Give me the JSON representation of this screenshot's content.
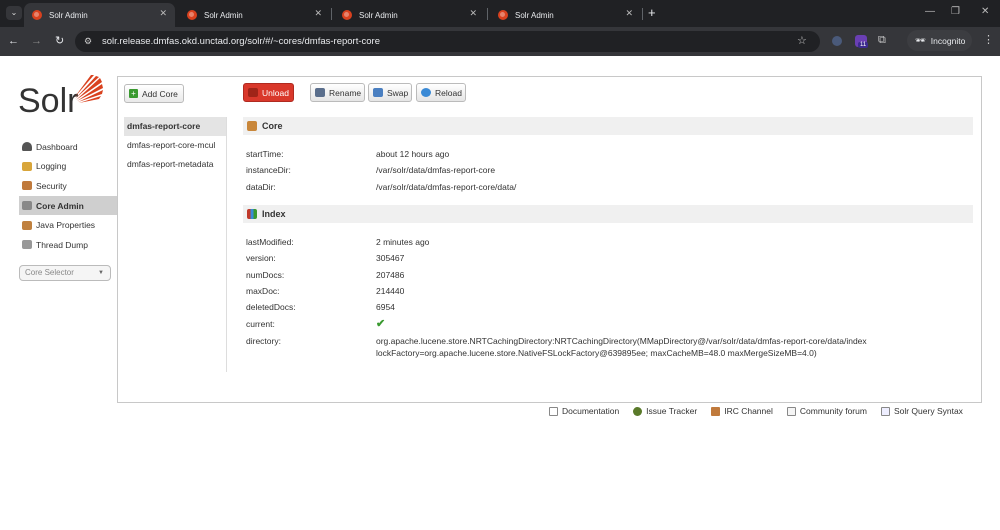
{
  "browser": {
    "tabs": [
      {
        "title": "Solr Admin"
      },
      {
        "title": "Solr Admin"
      },
      {
        "title": "Solr Admin"
      },
      {
        "title": "Solr Admin"
      }
    ],
    "url": "solr.release.dmfas.okd.unctad.org/solr/#/~cores/dmfas-report-core",
    "incognito_label": "Incognito",
    "extension_badge": "11"
  },
  "logo": {
    "text": "Solr"
  },
  "sidebar": {
    "items": [
      {
        "label": "Dashboard",
        "icon": "dashboard-icon",
        "color": "#555"
      },
      {
        "label": "Logging",
        "icon": "logging-icon",
        "color": "#d8a53a"
      },
      {
        "label": "Security",
        "icon": "security-icon",
        "color": "#c07a3c"
      },
      {
        "label": "Core Admin",
        "icon": "core-admin-icon",
        "color": "#888"
      },
      {
        "label": "Java Properties",
        "icon": "java-icon",
        "color": "#c0813f"
      },
      {
        "label": "Thread Dump",
        "icon": "thread-dump-icon",
        "color": "#999"
      }
    ],
    "active_index": 3,
    "core_selector_placeholder": "Core Selector"
  },
  "core_admin": {
    "add_core_label": "Add Core",
    "cores": [
      "dmfas-report-core",
      "dmfas-report-core-mcul",
      "dmfas-report-metadata"
    ],
    "active_core_index": 0,
    "actions": {
      "unload": "Unload",
      "rename": "Rename",
      "swap": "Swap",
      "reload": "Reload"
    },
    "core_section": {
      "title": "Core",
      "rows": [
        {
          "label": "startTime:",
          "value": "about 12 hours ago"
        },
        {
          "label": "instanceDir:",
          "value": "/var/solr/data/dmfas-report-core"
        },
        {
          "label": "dataDir:",
          "value": "/var/solr/data/dmfas-report-core/data/"
        }
      ]
    },
    "index_section": {
      "title": "Index",
      "rows": [
        {
          "label": "lastModified:",
          "value": "2 minutes ago"
        },
        {
          "label": "version:",
          "value": "305467"
        },
        {
          "label": "numDocs:",
          "value": "207486"
        },
        {
          "label": "maxDoc:",
          "value": "214440"
        },
        {
          "label": "deletedDocs:",
          "value": "6954"
        },
        {
          "label": "current:",
          "value": "✔"
        },
        {
          "label": "directory:",
          "value": "org.apache.lucene.store.NRTCachingDirectory:NRTCachingDirectory(MMapDirectory@/var/solr/data/dmfas-report-core/data/index",
          "value2": "lockFactory=org.apache.lucene.store.NativeFSLockFactory@639895ee; maxCacheMB=48.0 maxMergeSizeMB=4.0)"
        }
      ]
    }
  },
  "footer": {
    "links": [
      "Documentation",
      "Issue Tracker",
      "IRC Channel",
      "Community forum",
      "Solr Query Syntax"
    ]
  }
}
